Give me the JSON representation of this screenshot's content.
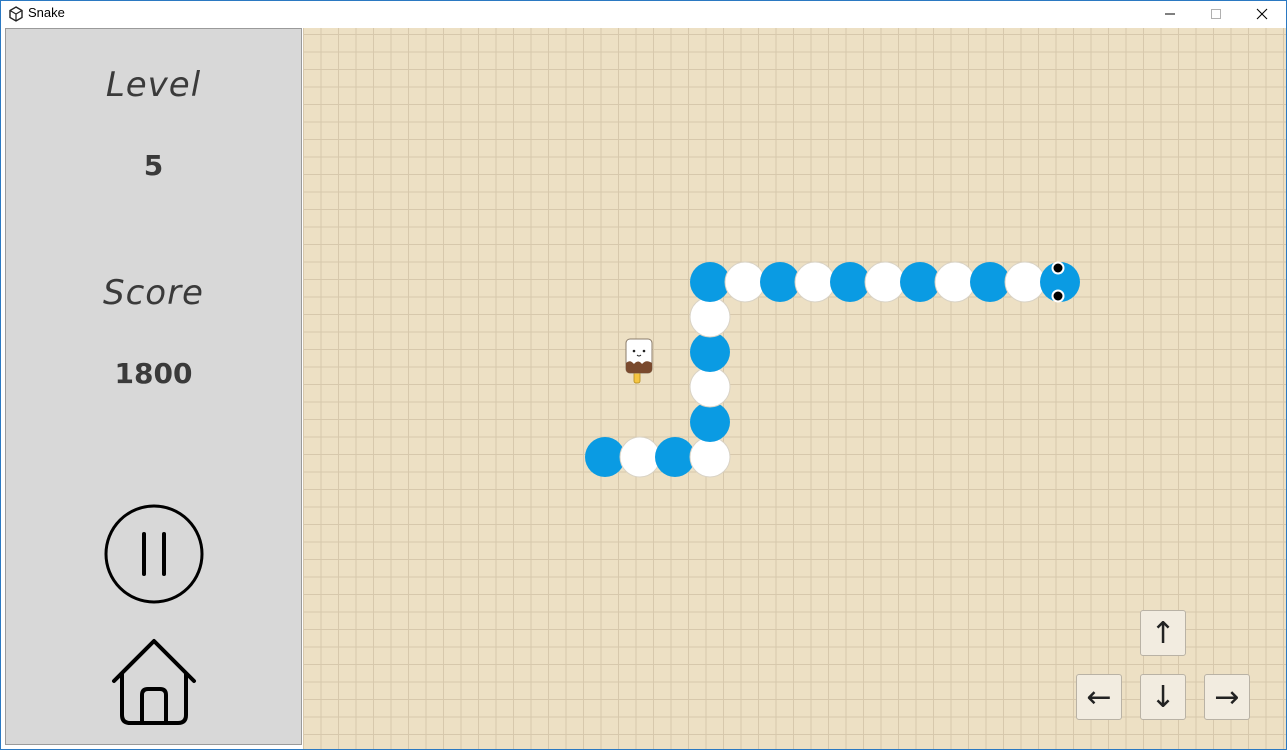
{
  "window": {
    "title": "Snake",
    "icon": "unity-logo-icon",
    "controls": {
      "minimize": "minimize-icon",
      "maximize": "maximize-icon",
      "close": "close-icon"
    }
  },
  "sidebar": {
    "level_label": "Level",
    "level_value": "5",
    "score_label": "Score",
    "score_value": "1800",
    "pause_icon": "pause-icon",
    "home_icon": "home-icon"
  },
  "board": {
    "background": "#ede0c4",
    "grid_color": "#d7c8ac",
    "snake": {
      "colors": {
        "blue": "#0a9be3",
        "white": "#ffffff"
      },
      "direction": "right",
      "segments": [
        {
          "col": 8,
          "row": 12,
          "color": "blue"
        },
        {
          "col": 9,
          "row": 12,
          "color": "white"
        },
        {
          "col": 10,
          "row": 12,
          "color": "blue"
        },
        {
          "col": 11,
          "row": 12,
          "color": "white"
        },
        {
          "col": 11,
          "row": 11,
          "color": "blue"
        },
        {
          "col": 11,
          "row": 10,
          "color": "white"
        },
        {
          "col": 11,
          "row": 9,
          "color": "blue"
        },
        {
          "col": 11,
          "row": 8,
          "color": "white"
        },
        {
          "col": 11,
          "row": 7,
          "color": "blue"
        },
        {
          "col": 12,
          "row": 7,
          "color": "white"
        },
        {
          "col": 13,
          "row": 7,
          "color": "blue"
        },
        {
          "col": 14,
          "row": 7,
          "color": "white"
        },
        {
          "col": 15,
          "row": 7,
          "color": "blue"
        },
        {
          "col": 16,
          "row": 7,
          "color": "white"
        },
        {
          "col": 17,
          "row": 7,
          "color": "blue"
        },
        {
          "col": 18,
          "row": 7,
          "color": "white"
        },
        {
          "col": 19,
          "row": 7,
          "color": "blue"
        },
        {
          "col": 20,
          "row": 7,
          "color": "white"
        },
        {
          "col": 21,
          "row": 7,
          "color": "head"
        }
      ]
    },
    "food": {
      "icon": "ice-cream-icon",
      "col": 9,
      "row": 9
    }
  },
  "controls": {
    "up": "↑",
    "left": "←",
    "down": "↓",
    "right": "→"
  }
}
